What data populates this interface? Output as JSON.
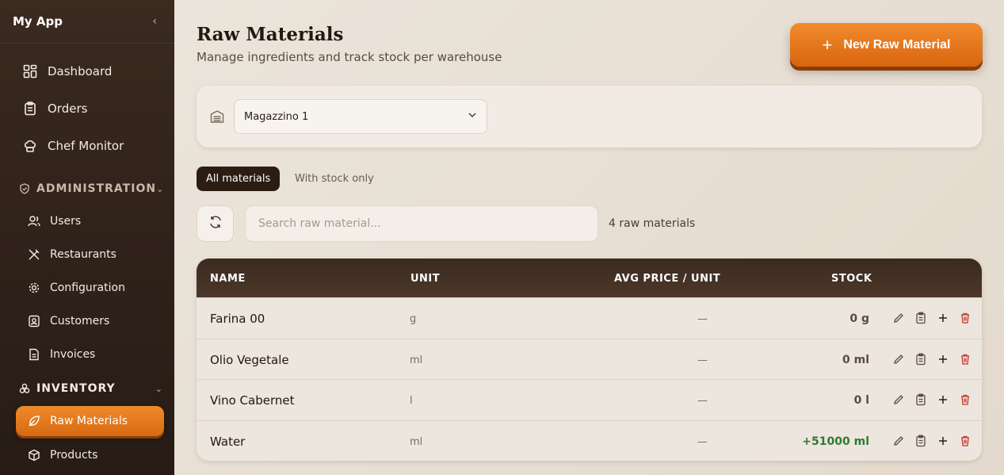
{
  "app": {
    "title": "My App"
  },
  "sidebar": {
    "items": [
      {
        "label": "Dashboard"
      },
      {
        "label": "Orders"
      },
      {
        "label": "Chef Monitor"
      }
    ],
    "administration": {
      "label": "ADMINISTRATION",
      "items": [
        {
          "label": "Users"
        },
        {
          "label": "Restaurants"
        },
        {
          "label": "Configuration"
        },
        {
          "label": "Customers"
        },
        {
          "label": "Invoices"
        }
      ]
    },
    "inventory": {
      "label": "INVENTORY",
      "items": [
        {
          "label": "Raw Materials"
        },
        {
          "label": "Products"
        }
      ]
    }
  },
  "page": {
    "title": "Raw Materials",
    "subtitle": "Manage ingredients and track stock per warehouse",
    "new_button": "New Raw Material"
  },
  "warehouse": {
    "selected": "Magazzino 1"
  },
  "filters": {
    "all": "All materials",
    "stock_only": "With stock only"
  },
  "search": {
    "placeholder": "Search raw material...",
    "count": "4 raw materials"
  },
  "table": {
    "headers": {
      "name": "NAME",
      "unit": "UNIT",
      "avg": "AVG PRICE / UNIT",
      "stock": "STOCK"
    },
    "rows": [
      {
        "name": "Farina 00",
        "unit": "g",
        "avg": "—",
        "stock": "0 g"
      },
      {
        "name": "Olio Vegetale",
        "unit": "ml",
        "avg": "—",
        "stock": "0 ml"
      },
      {
        "name": "Vino Cabernet",
        "unit": "l",
        "avg": "—",
        "stock": "0 l"
      },
      {
        "name": "Water",
        "unit": "ml",
        "avg": "—",
        "stock": "+51000 ml"
      }
    ]
  },
  "colors": {
    "accent": "#e2761c",
    "header_dark": "#3b2a1f",
    "positive": "#2f7a2f",
    "danger": "#c0392b"
  }
}
